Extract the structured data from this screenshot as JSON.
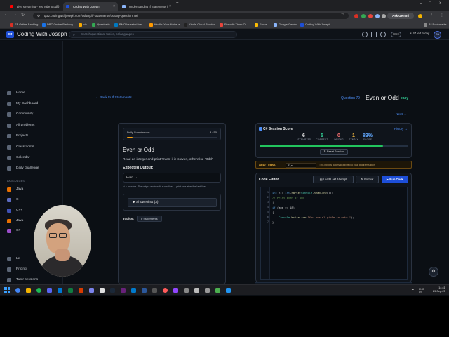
{
  "browser": {
    "tabs": [
      {
        "label": "Live streaming - YouTube Studio",
        "color": "#ff0000",
        "active": false
      },
      {
        "label": "Coding With Joseph",
        "color": "#1e4fd6",
        "active": true
      },
      {
        "label": "Understanding If Statements i",
        "color": "#8ab4f8",
        "active": false
      }
    ],
    "url": "quiz.codingwithjoseph.com/csharp/if-statements/csharp-question-79/",
    "profile_label": "Ask Gemini",
    "bookmarks": [
      {
        "label": "EF Online Banking",
        "color": "#d93025"
      },
      {
        "label": "DBC Online Banking",
        "color": "#1a73e8"
      },
      {
        "label": "cic",
        "color": "#f9ab00"
      },
      {
        "label": "Questrade",
        "color": "#34a853"
      },
      {
        "label": "BMO InvestorLine -",
        "color": "#0079c1"
      },
      {
        "label": "Kindle: Your Notes a...",
        "color": "#ff9900"
      },
      {
        "label": "Kindle Cloud Reader",
        "color": "#222222"
      },
      {
        "label": "Periodic Timer O...",
        "color": "#e8453c"
      },
      {
        "label": "Focus",
        "color": "#fbbc04"
      },
      {
        "label": "Google Gemini",
        "color": "#8ab4f8"
      },
      {
        "label": "Coding With Joseph",
        "color": "#1e4fd6"
      }
    ],
    "all_bookmarks": "All Bookmarks"
  },
  "header": {
    "logo_text": "CJ",
    "brand": "Coding With Joseph",
    "search_placeholder": "Search questions, topics, or languages",
    "free_badge": "FREE",
    "streak": "47 left today",
    "avatar": "CA"
  },
  "sidebar": {
    "items": [
      {
        "label": "Home"
      },
      {
        "label": "My Dashboard"
      },
      {
        "label": "Community"
      },
      {
        "label": "All problems"
      },
      {
        "label": "Projects"
      },
      {
        "label": "Classrooms"
      },
      {
        "label": "Calendar"
      },
      {
        "label": "Daily challenge"
      }
    ],
    "languages_label": "LANGUAGES",
    "languages": [
      {
        "label": "Java"
      },
      {
        "label": "C"
      },
      {
        "label": "C++"
      },
      {
        "label": "Java"
      },
      {
        "label": "C#"
      }
    ],
    "bottom": [
      {
        "label": "Le"
      },
      {
        "label": "Pricing"
      },
      {
        "label": "Tutor sessions"
      }
    ]
  },
  "question": {
    "back_link": "← Back to If Statements",
    "number": "Question 79",
    "title": "Even or Odd",
    "difficulty": "easy",
    "next": "Next →",
    "daily_label": "Daily Submissions",
    "daily_count": "3 / 50",
    "daily_progress": 0.06,
    "desc": "Read an integer and print 'Even' if it is even, otherwise 'Odd'.",
    "expected_label": "Expected Output:",
    "expected_value": "Even ↵",
    "newline_note": "↵ = newline. The output ends with a newline — print one after the last line.",
    "hints_button": "▶ Show Hints (3)",
    "topics_label": "Topics:",
    "topic": "If Statements"
  },
  "session": {
    "title": "C# Session Score",
    "history": "History →",
    "stats": [
      {
        "num": "6",
        "label": "ATTEMPTED",
        "color": "#e6e6e6"
      },
      {
        "num": "5",
        "label": "CORRECT",
        "color": "#34d399"
      },
      {
        "num": "0",
        "label": "WRONG",
        "color": "#f87171"
      },
      {
        "num": "1",
        "label": "SYNTAX",
        "color": "#f5b942"
      },
      {
        "num": "83%",
        "label": "SCORE",
        "color": "#60a5fa"
      }
    ],
    "score_progress": 0.83,
    "reset_label": "↻ Reset Session"
  },
  "auto_input": {
    "label": "Auto - Input:",
    "value": "4\\n",
    "note": "This input is automatically fed to your program's stdin"
  },
  "editor": {
    "title": "Code Editor",
    "load_label": "Load Last Attempt",
    "format_label": "Format",
    "run_label": "▶ Run Code",
    "lines": [
      "1",
      "2",
      "3",
      "4",
      "5",
      "6",
      "7"
    ]
  },
  "taskbar": {
    "time": "14:41",
    "date": "29-Sep-25",
    "lang": "ENG",
    "region": "US"
  }
}
